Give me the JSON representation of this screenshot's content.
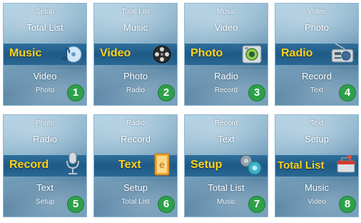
{
  "screens": [
    {
      "prev2": "Setup",
      "prev1": "Total List",
      "selected": "Music",
      "next1": "Video",
      "next2": "Photo",
      "badge": "1",
      "icon": "music-note-cd-icon"
    },
    {
      "prev2": "Total List",
      "prev1": "Music",
      "selected": "Video",
      "next1": "Photo",
      "next2": "Radio",
      "badge": "2",
      "icon": "film-reel-icon"
    },
    {
      "prev2": "Music",
      "prev1": "Video",
      "selected": "Photo",
      "next1": "Radio",
      "next2": "Record",
      "badge": "3",
      "icon": "camera-icon"
    },
    {
      "prev2": "Video",
      "prev1": "Photo",
      "selected": "Radio",
      "next1": "Record",
      "next2": "Text",
      "badge": "4",
      "icon": "radio-icon"
    },
    {
      "prev2": "Photo",
      "prev1": "Radio",
      "selected": "Record",
      "next1": "Text",
      "next2": "Setup",
      "badge": "5",
      "icon": "microphone-icon"
    },
    {
      "prev2": "Radio",
      "prev1": "Record",
      "selected": "Text",
      "next1": "Setup",
      "next2": "Total List",
      "badge": "6",
      "icon": "text-document-icon"
    },
    {
      "prev2": "Record",
      "prev1": "Text",
      "selected": "Setup",
      "next1": "Total List",
      "next2": "Music",
      "badge": "7",
      "icon": "gears-icon"
    },
    {
      "prev2": "Text",
      "prev1": "Setup",
      "selected": "Total List",
      "next1": "Music",
      "next2": "Video",
      "badge": "8",
      "icon": "toolbox-icon"
    }
  ],
  "colors": {
    "selected_text": "#ffd21a",
    "badge": "#2fa04a",
    "band": "#1f5a86"
  }
}
